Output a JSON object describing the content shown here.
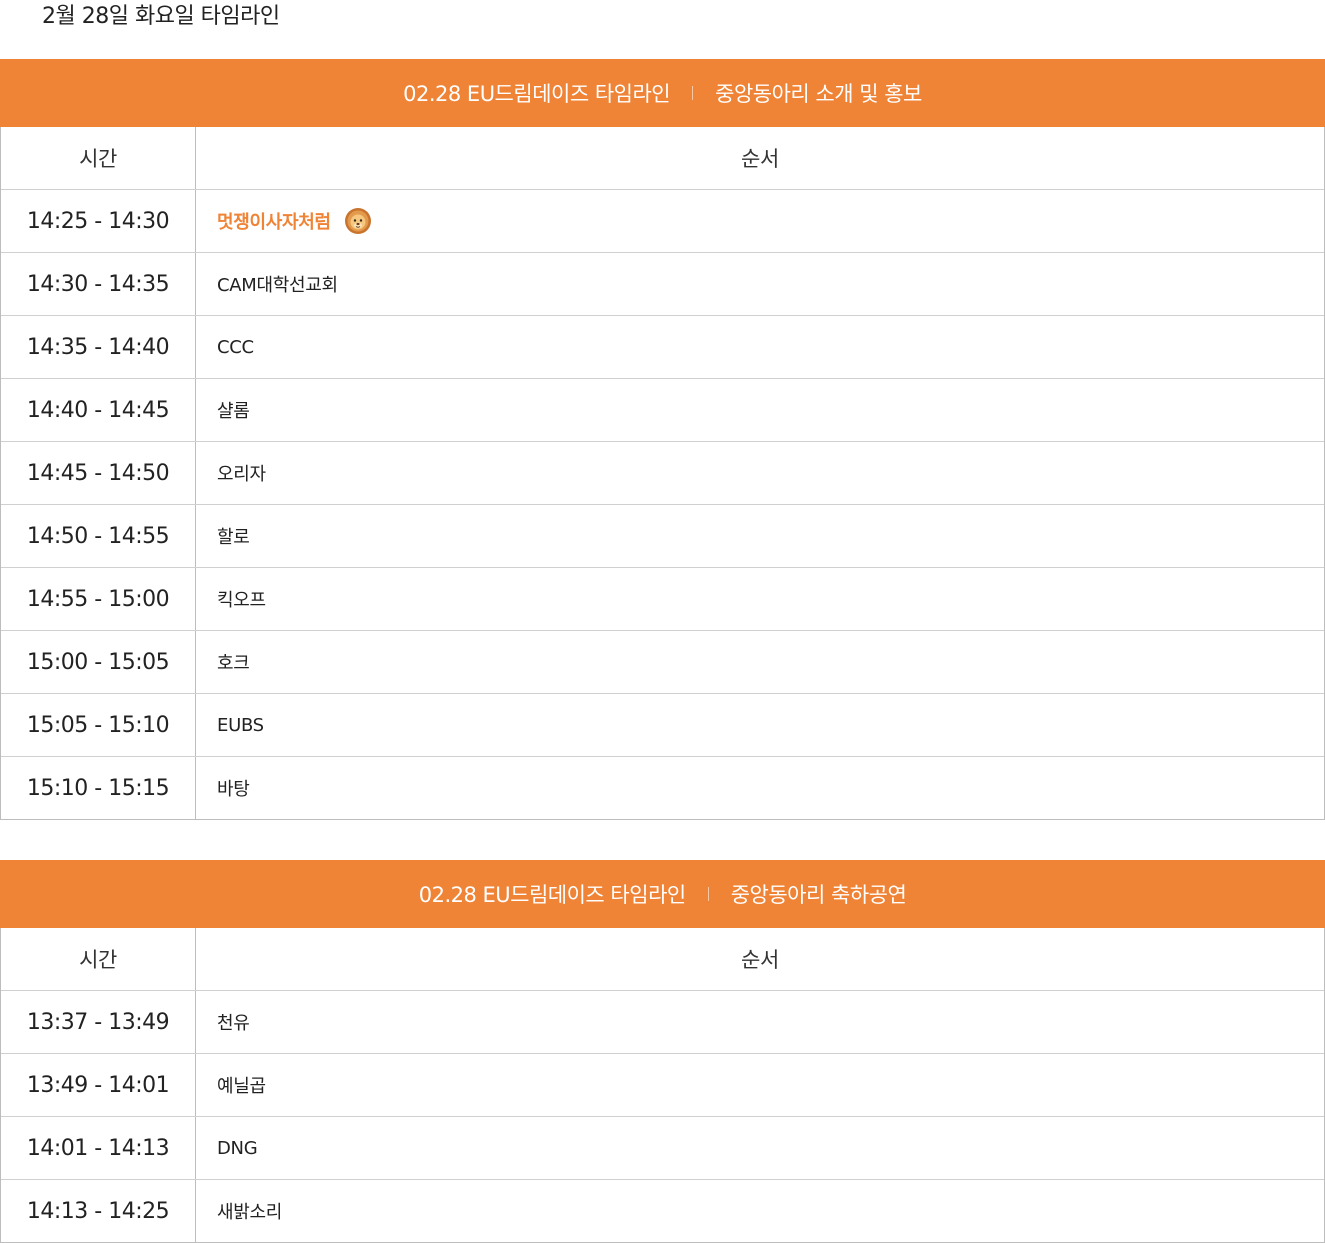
{
  "page_heading": "2월 28일 화요일 타임라인",
  "colors": {
    "accent": "#ef8336",
    "header_text": "#ffffff",
    "border": "#bdbdbd"
  },
  "tables": [
    {
      "header_left": "02.28  EU드림데이즈 타임라인",
      "header_right": "중앙동아리 소개 및 홍보",
      "col_time": "시간",
      "col_order": "순서",
      "rows": [
        {
          "time": "14:25 - 14:30",
          "order": "멋쟁이사자처럼",
          "icon": "lion-icon",
          "highlight": true
        },
        {
          "time": "14:30 - 14:35",
          "order": "CAM대학선교회"
        },
        {
          "time": "14:35 - 14:40",
          "order": "CCC"
        },
        {
          "time": "14:40 - 14:45",
          "order": "샬롬"
        },
        {
          "time": "14:45 - 14:50",
          "order": "오리자"
        },
        {
          "time": "14:50 - 14:55",
          "order": "할로"
        },
        {
          "time": "14:55 - 15:00",
          "order": "킥오프"
        },
        {
          "time": "15:00 - 15:05",
          "order": "호크"
        },
        {
          "time": "15:05 - 15:10",
          "order": "EUBS"
        },
        {
          "time": "15:10 - 15:15",
          "order": "바탕"
        }
      ]
    },
    {
      "header_left": "02.28  EU드림데이즈 타임라인",
      "header_right": "중앙동아리 축하공연",
      "col_time": "시간",
      "col_order": "순서",
      "rows": [
        {
          "time": "13:37 - 13:49",
          "order": "천유"
        },
        {
          "time": "13:49 - 14:01",
          "order": "예닐곱"
        },
        {
          "time": "14:01 - 14:13",
          "order": "DNG"
        },
        {
          "time": "14:13 - 14:25",
          "order": "새밝소리"
        }
      ]
    }
  ]
}
